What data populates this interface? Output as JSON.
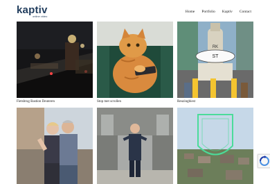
{
  "header": {
    "logo": {
      "name": "kaptiv",
      "tagline": "online video"
    },
    "nav": [
      {
        "label": "Home"
      },
      {
        "label": "Portfolio"
      },
      {
        "label": "Kaptiv"
      },
      {
        "label": "Contact"
      }
    ]
  },
  "portfolio": {
    "items": [
      {
        "caption": "Fietsbrug Bastion Deuteren",
        "image": "night-bridge-scene"
      },
      {
        "caption": "Stop met scrollen",
        "image": "cat-with-phone"
      },
      {
        "caption": "Reuzingbiest",
        "image": "giant-beer-bottle-monument"
      },
      {
        "caption": "",
        "image": "couple-outdoors"
      },
      {
        "caption": "",
        "image": "presenter-on-platform"
      },
      {
        "caption": "",
        "image": "aerial-city-outline"
      }
    ]
  },
  "recaptcha": {
    "icon": "recaptcha-icon"
  }
}
